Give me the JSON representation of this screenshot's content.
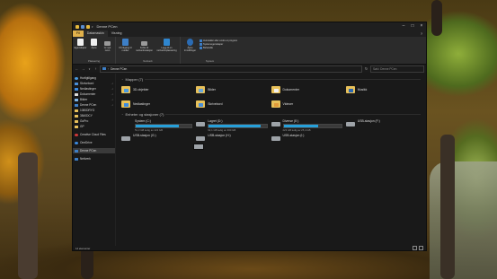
{
  "window": {
    "title": "Denne PCen"
  },
  "tabs": {
    "file": "Fil",
    "computer": "Datamaskin",
    "view": "Visning"
  },
  "ribbon": {
    "groups": [
      {
        "label": "Plassering",
        "buttons": [
          "Egenskaper",
          "Åpne",
          "Gi nytt navn"
        ]
      },
      {
        "label": "Nettverk",
        "buttons": [
          "Få tilgang til medier",
          "Koble til nettverksstasjon",
          "Legg til en nettverksplassering"
        ]
      },
      {
        "label": "System",
        "buttons": [
          "Åpne Innstillinger"
        ],
        "items": [
          "Avinstaller eller endre et program",
          "Systemegenskaper",
          "Behandle"
        ]
      }
    ]
  },
  "address": {
    "path": "Denne PCen",
    "search_placeholder": "Søk i Denne PCen"
  },
  "sidebar": {
    "items": [
      {
        "label": "Hurtigtilgang",
        "icon": "star-icon",
        "pinned": false
      },
      {
        "label": "Skrivebord",
        "icon": "desktop-icon",
        "pinned": true
      },
      {
        "label": "Nedlastinger",
        "icon": "download-icon",
        "pinned": true
      },
      {
        "label": "Dokumenter",
        "icon": "document-icon",
        "pinned": true
      },
      {
        "label": "Bilder",
        "icon": "pictures-icon",
        "pinned": true
      },
      {
        "label": "Denne PCen",
        "icon": "pc-icon",
        "pinned": true
      },
      {
        "label": "1080DRYO",
        "icon": "folder-icon",
        "pinned": false
      },
      {
        "label": "3840DCY",
        "icon": "folder-icon",
        "pinned": false
      },
      {
        "label": "GoPro",
        "icon": "folder-icon",
        "pinned": false
      },
      {
        "label": "GP",
        "icon": "folder-icon",
        "pinned": false
      },
      {
        "label": "Creative Cloud Files",
        "icon": "creative-cloud-icon",
        "pinned": false
      },
      {
        "label": "OneDrive",
        "icon": "onedrive-icon",
        "pinned": false
      },
      {
        "label": "Denne PCen",
        "icon": "pc-icon",
        "pinned": false
      },
      {
        "label": "Nettverk",
        "icon": "network-icon",
        "pinned": false
      }
    ]
  },
  "main": {
    "folders_header": "Mapper (7)",
    "folders": [
      {
        "label": "3D-objekter",
        "type": "obj"
      },
      {
        "label": "Bilder",
        "type": "pic"
      },
      {
        "label": "Dokumenter",
        "type": "doc"
      },
      {
        "label": "Musikk",
        "type": "mus"
      },
      {
        "label": "Nedlastinger",
        "type": "dl"
      },
      {
        "label": "Skrivebord",
        "type": "desk"
      },
      {
        "label": "Videoer",
        "type": "vid"
      }
    ],
    "drives_header": "Enheter og stasjoner (7)",
    "drives": [
      {
        "label": "System (C:)",
        "free": "51,3 GB ledig av 222 GB",
        "used_fraction": 0.77,
        "windows": true,
        "bar": true
      },
      {
        "label": "Lagret (D:)",
        "free": "92,1 GB ledig av 930 GB",
        "used_fraction": 0.9,
        "windows": false,
        "bar": true
      },
      {
        "label": "Diverse (E:)",
        "free": "223 GB ledig av 25,4 GB",
        "used_fraction": 0.6,
        "windows": false,
        "bar": true
      },
      {
        "label": "USB-stasjon (F:)",
        "free": "",
        "used_fraction": 0,
        "windows": false,
        "bar": false
      },
      {
        "label": "USB-stasjon (G:)",
        "free": "",
        "used_fraction": 0,
        "windows": false,
        "bar": false
      },
      {
        "label": "USB-stasjon (H:)",
        "free": "",
        "used_fraction": 0,
        "windows": false,
        "bar": false
      },
      {
        "label": "USB-stasjon (I:)",
        "free": "",
        "used_fraction": 0,
        "windows": false,
        "bar": false
      }
    ]
  },
  "status": {
    "count": "14 elementer"
  }
}
